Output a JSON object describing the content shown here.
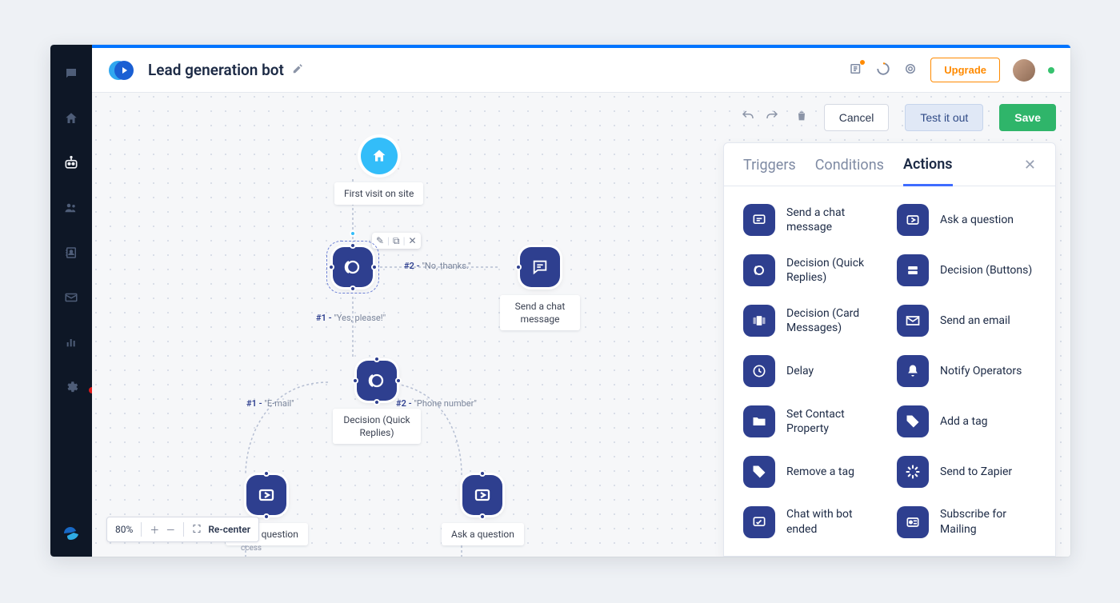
{
  "header": {
    "title": "Lead generation bot",
    "upgrade": "Upgrade"
  },
  "action_bar": {
    "cancel": "Cancel",
    "test": "Test it out",
    "save": "Save"
  },
  "panel": {
    "tabs": {
      "triggers": "Triggers",
      "conditions": "Conditions",
      "actions": "Actions"
    },
    "actions": {
      "chat_message": "Send a chat message",
      "ask_question": "Ask a question",
      "decision_quick": "Decision (Quick Replies)",
      "decision_buttons": "Decision (Buttons)",
      "decision_card": "Decision (Card Messages)",
      "send_email": "Send an email",
      "delay": "Delay",
      "notify_operators": "Notify Operators",
      "set_contact": "Set Contact Property",
      "add_tag": "Add a tag",
      "remove_tag": "Remove a tag",
      "send_zapier": "Send to Zapier",
      "chat_ended": "Chat with bot ended",
      "subscribe_mailing": "Subscribe for Mailing"
    }
  },
  "flow": {
    "start_label": "First visit on site",
    "decision1": {
      "branch1_hash": "#1 - ",
      "branch1_text": "\"Yes, please!\"",
      "branch2_hash": "#2 - ",
      "branch2_text": "\"No, thanks.\""
    },
    "chat_msg_label": "Send a chat message",
    "decision2": {
      "label": "Decision (Quick Replies)",
      "branch1_hash": "#1 - ",
      "branch1_text": "\"E-mail\"",
      "branch2_hash": "#2 - ",
      "branch2_text": "\"Phone number\""
    },
    "ask_left": "Ask a question",
    "ask_right": "Ask a question",
    "cropped": "ccess"
  },
  "bottom": {
    "zoom": "80%",
    "recenter": "Re-center"
  }
}
